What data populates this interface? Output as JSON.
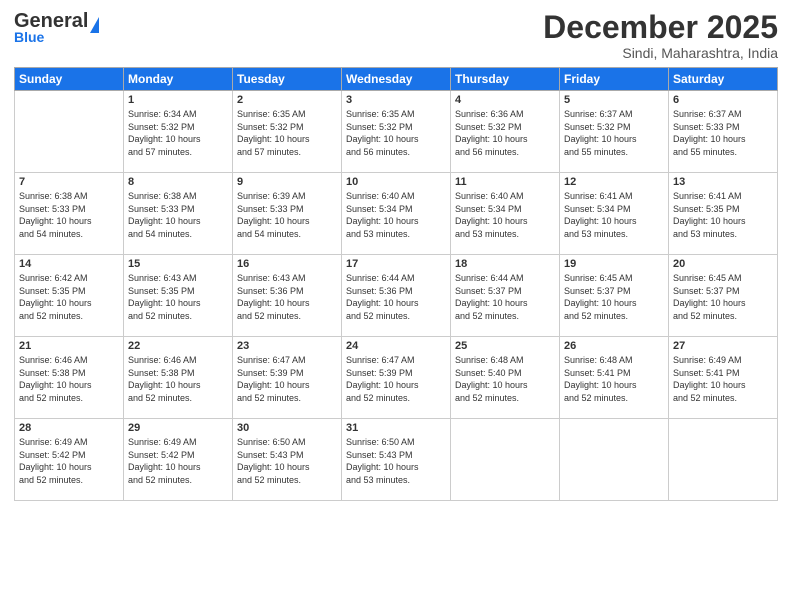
{
  "header": {
    "logo_line1": "General",
    "logo_line2": "Blue",
    "month": "December 2025",
    "location": "Sindi, Maharashtra, India"
  },
  "weekdays": [
    "Sunday",
    "Monday",
    "Tuesday",
    "Wednesday",
    "Thursday",
    "Friday",
    "Saturday"
  ],
  "weeks": [
    [
      {
        "day": "",
        "info": ""
      },
      {
        "day": "1",
        "info": "Sunrise: 6:34 AM\nSunset: 5:32 PM\nDaylight: 10 hours\nand 57 minutes."
      },
      {
        "day": "2",
        "info": "Sunrise: 6:35 AM\nSunset: 5:32 PM\nDaylight: 10 hours\nand 57 minutes."
      },
      {
        "day": "3",
        "info": "Sunrise: 6:35 AM\nSunset: 5:32 PM\nDaylight: 10 hours\nand 56 minutes."
      },
      {
        "day": "4",
        "info": "Sunrise: 6:36 AM\nSunset: 5:32 PM\nDaylight: 10 hours\nand 56 minutes."
      },
      {
        "day": "5",
        "info": "Sunrise: 6:37 AM\nSunset: 5:32 PM\nDaylight: 10 hours\nand 55 minutes."
      },
      {
        "day": "6",
        "info": "Sunrise: 6:37 AM\nSunset: 5:33 PM\nDaylight: 10 hours\nand 55 minutes."
      }
    ],
    [
      {
        "day": "7",
        "info": "Sunrise: 6:38 AM\nSunset: 5:33 PM\nDaylight: 10 hours\nand 54 minutes."
      },
      {
        "day": "8",
        "info": "Sunrise: 6:38 AM\nSunset: 5:33 PM\nDaylight: 10 hours\nand 54 minutes."
      },
      {
        "day": "9",
        "info": "Sunrise: 6:39 AM\nSunset: 5:33 PM\nDaylight: 10 hours\nand 54 minutes."
      },
      {
        "day": "10",
        "info": "Sunrise: 6:40 AM\nSunset: 5:34 PM\nDaylight: 10 hours\nand 53 minutes."
      },
      {
        "day": "11",
        "info": "Sunrise: 6:40 AM\nSunset: 5:34 PM\nDaylight: 10 hours\nand 53 minutes."
      },
      {
        "day": "12",
        "info": "Sunrise: 6:41 AM\nSunset: 5:34 PM\nDaylight: 10 hours\nand 53 minutes."
      },
      {
        "day": "13",
        "info": "Sunrise: 6:41 AM\nSunset: 5:35 PM\nDaylight: 10 hours\nand 53 minutes."
      }
    ],
    [
      {
        "day": "14",
        "info": "Sunrise: 6:42 AM\nSunset: 5:35 PM\nDaylight: 10 hours\nand 52 minutes."
      },
      {
        "day": "15",
        "info": "Sunrise: 6:43 AM\nSunset: 5:35 PM\nDaylight: 10 hours\nand 52 minutes."
      },
      {
        "day": "16",
        "info": "Sunrise: 6:43 AM\nSunset: 5:36 PM\nDaylight: 10 hours\nand 52 minutes."
      },
      {
        "day": "17",
        "info": "Sunrise: 6:44 AM\nSunset: 5:36 PM\nDaylight: 10 hours\nand 52 minutes."
      },
      {
        "day": "18",
        "info": "Sunrise: 6:44 AM\nSunset: 5:37 PM\nDaylight: 10 hours\nand 52 minutes."
      },
      {
        "day": "19",
        "info": "Sunrise: 6:45 AM\nSunset: 5:37 PM\nDaylight: 10 hours\nand 52 minutes."
      },
      {
        "day": "20",
        "info": "Sunrise: 6:45 AM\nSunset: 5:37 PM\nDaylight: 10 hours\nand 52 minutes."
      }
    ],
    [
      {
        "day": "21",
        "info": "Sunrise: 6:46 AM\nSunset: 5:38 PM\nDaylight: 10 hours\nand 52 minutes."
      },
      {
        "day": "22",
        "info": "Sunrise: 6:46 AM\nSunset: 5:38 PM\nDaylight: 10 hours\nand 52 minutes."
      },
      {
        "day": "23",
        "info": "Sunrise: 6:47 AM\nSunset: 5:39 PM\nDaylight: 10 hours\nand 52 minutes."
      },
      {
        "day": "24",
        "info": "Sunrise: 6:47 AM\nSunset: 5:39 PM\nDaylight: 10 hours\nand 52 minutes."
      },
      {
        "day": "25",
        "info": "Sunrise: 6:48 AM\nSunset: 5:40 PM\nDaylight: 10 hours\nand 52 minutes."
      },
      {
        "day": "26",
        "info": "Sunrise: 6:48 AM\nSunset: 5:41 PM\nDaylight: 10 hours\nand 52 minutes."
      },
      {
        "day": "27",
        "info": "Sunrise: 6:49 AM\nSunset: 5:41 PM\nDaylight: 10 hours\nand 52 minutes."
      }
    ],
    [
      {
        "day": "28",
        "info": "Sunrise: 6:49 AM\nSunset: 5:42 PM\nDaylight: 10 hours\nand 52 minutes."
      },
      {
        "day": "29",
        "info": "Sunrise: 6:49 AM\nSunset: 5:42 PM\nDaylight: 10 hours\nand 52 minutes."
      },
      {
        "day": "30",
        "info": "Sunrise: 6:50 AM\nSunset: 5:43 PM\nDaylight: 10 hours\nand 52 minutes."
      },
      {
        "day": "31",
        "info": "Sunrise: 6:50 AM\nSunset: 5:43 PM\nDaylight: 10 hours\nand 53 minutes."
      },
      {
        "day": "",
        "info": ""
      },
      {
        "day": "",
        "info": ""
      },
      {
        "day": "",
        "info": ""
      }
    ]
  ]
}
